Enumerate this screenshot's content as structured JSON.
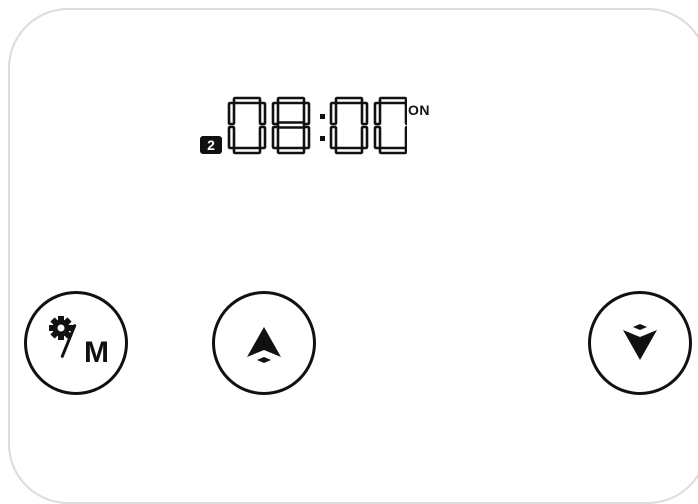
{
  "display": {
    "timer_number": "2",
    "time": "08:00",
    "state": "ON"
  },
  "controls": {
    "menu_button": {
      "icon": "gear-icon",
      "label": "M"
    },
    "up_button": {
      "icon": "arrow-up-icon"
    },
    "down_button": {
      "icon": "arrow-down-icon"
    }
  },
  "colors": {
    "foreground": "#111111",
    "background": "#ffffff",
    "panel_border": "#dcdcdc"
  }
}
